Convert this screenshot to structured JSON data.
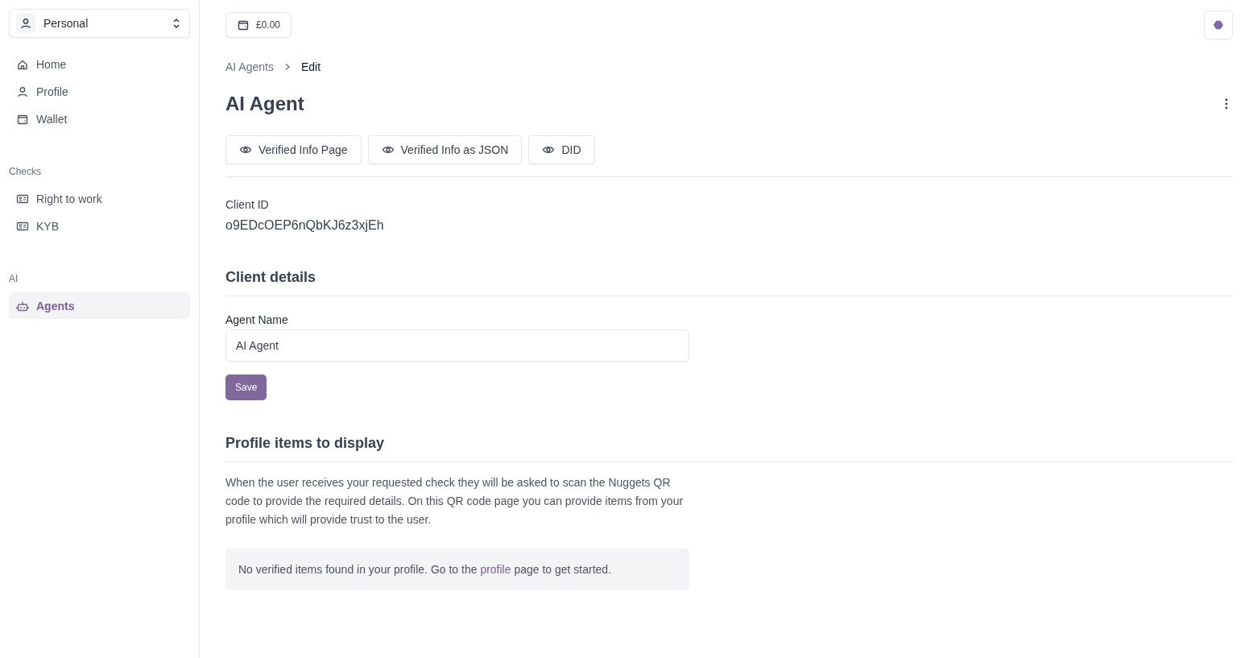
{
  "account_switcher": {
    "label": "Personal"
  },
  "sidebar": {
    "sections": [
      {
        "items": [
          {
            "label": "Home",
            "selected": false
          },
          {
            "label": "Profile",
            "selected": false
          },
          {
            "label": "Wallet",
            "selected": false
          }
        ]
      },
      {
        "title": "Checks",
        "items": [
          {
            "label": "Right to work",
            "selected": false
          },
          {
            "label": "KYB",
            "selected": false
          }
        ]
      },
      {
        "title": "AI",
        "items": [
          {
            "label": "Agents",
            "selected": true
          }
        ]
      }
    ]
  },
  "topbar": {
    "balance": "£0.00"
  },
  "breadcrumb": [
    {
      "label": "AI Agents"
    },
    {
      "label": "Edit"
    }
  ],
  "page_title": "AI Agent",
  "action_buttons": [
    "Verified Info Page",
    "Verified Info as JSON",
    "DID"
  ],
  "client_id": {
    "label": "Client ID",
    "value": "o9EDcOEP6nQbKJ6z3xjEh"
  },
  "client_details": {
    "heading": "Client details",
    "field_label": "Agent Name",
    "field_value": "AI Agent",
    "save": "Save"
  },
  "profile_items": {
    "heading": "Profile items to display",
    "description": "When the user receives your requested check they will be asked to scan the Nuggets QR code to provide the required details. On this QR code page you can provide items from your profile which will provide trust to the user.",
    "notice_before": "No verified items found in your profile. Go to the ",
    "notice_link": "profile",
    "notice_after": " page to get started."
  }
}
